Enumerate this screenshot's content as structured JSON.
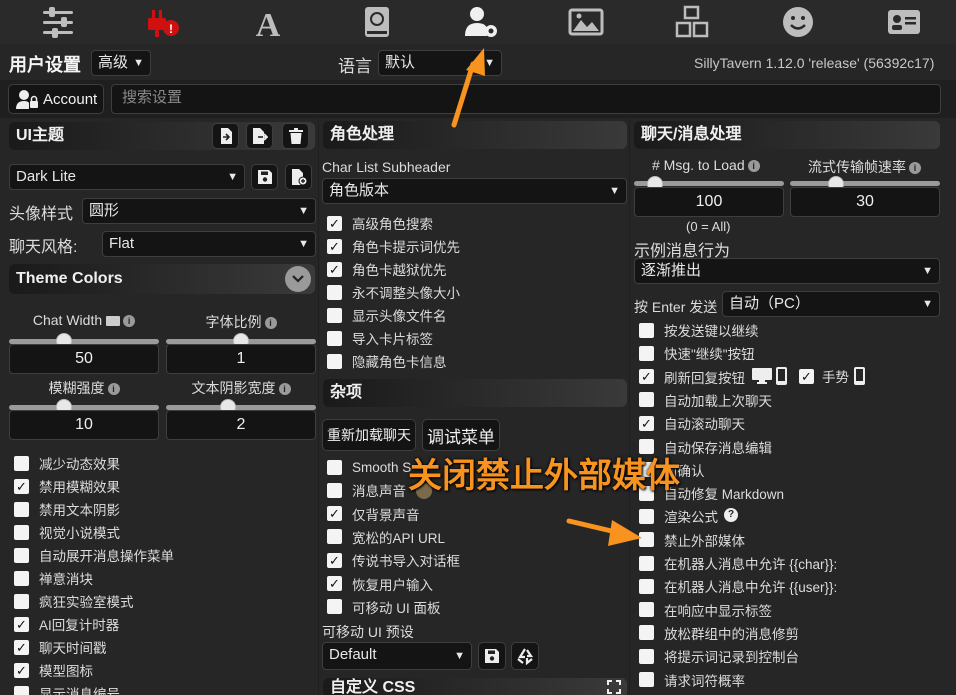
{
  "topbar": {
    "icons": [
      "sliders-icon",
      "plug-warning-icon",
      "font-icon",
      "book-globe-icon",
      "user-gear-icon",
      "image-icon",
      "cubes-icon",
      "smile-icon",
      "id-card-icon"
    ]
  },
  "header": {
    "title": "用户设置",
    "mode": "高级",
    "language_label": "语言",
    "language_value": "默认",
    "version": "SillyTavern 1.12.0 'release' (56392c17)"
  },
  "account": {
    "label": "Account",
    "search_placeholder": "搜索设置"
  },
  "ui_theme": {
    "title": "UI主题",
    "theme": "Dark Lite",
    "avatar_style_label": "头像样式",
    "avatar_style": "圆形",
    "chat_style_label": "聊天风格:",
    "chat_style": "Flat",
    "theme_colors": "Theme Colors",
    "sliders": [
      {
        "label": "Chat Width",
        "value": "50",
        "fraction": 0.35
      },
      {
        "label": "字体比例",
        "value": "1",
        "fraction": 0.5
      },
      {
        "label": "模糊强度",
        "value": "10",
        "fraction": 0.35
      },
      {
        "label": "文本阴影宽度",
        "value": "2",
        "fraction": 0.4
      }
    ],
    "checkboxes": [
      {
        "label": "减少动态效果",
        "checked": false
      },
      {
        "label": "禁用模糊效果",
        "checked": true
      },
      {
        "label": "禁用文本阴影",
        "checked": false
      },
      {
        "label": "视觉小说模式",
        "checked": false
      },
      {
        "label": "自动展开消息操作菜单",
        "checked": false
      },
      {
        "label": "禅意消块",
        "checked": false
      },
      {
        "label": "疯狂实验室模式",
        "checked": false
      },
      {
        "label": "AI回复计时器",
        "checked": true
      },
      {
        "label": "聊天时间戳",
        "checked": true
      },
      {
        "label": "模型图标",
        "checked": true
      },
      {
        "label": "显示消息编号",
        "checked": false
      }
    ]
  },
  "char_handling": {
    "title": "角色处理",
    "subheader_label": "Char List Subheader",
    "subheader_value": "角色版本",
    "checkboxes": [
      {
        "label": "高级角色搜索",
        "checked": true
      },
      {
        "label": "角色卡提示词优先",
        "checked": true
      },
      {
        "label": "角色卡越狱优先",
        "checked": true
      },
      {
        "label": "永不调整头像大小",
        "checked": false
      },
      {
        "label": "显示头像文件名",
        "checked": false
      },
      {
        "label": "导入卡片标签",
        "checked": false
      },
      {
        "label": "隐藏角色卡信息",
        "checked": false
      }
    ]
  },
  "misc": {
    "title": "杂项",
    "reload_button": "重新加载聊天",
    "debug_button": "调试菜单",
    "checkboxes": [
      {
        "label": "Smooth S",
        "checked": false
      },
      {
        "label": "消息声音",
        "checked": false
      },
      {
        "label": "仅背景声音",
        "checked": true
      },
      {
        "label": "宽松的API URL",
        "checked": false
      },
      {
        "label": "传说书导入对话框",
        "checked": true
      },
      {
        "label": "恢复用户输入",
        "checked": true
      },
      {
        "label": "可移动 UI 面板",
        "checked": false
      }
    ],
    "preset_label": "可移动 UI 预设",
    "preset_value": "Default",
    "custom_css": "自定义 CSS"
  },
  "chat_handling": {
    "title": "聊天/消息处理",
    "msg_load_label": "# Msg. to Load",
    "msg_load_value": "100",
    "msg_load_fraction": 0.1,
    "msg_load_note": "(0 = All)",
    "stream_fps_label": "流式传输帧速率",
    "stream_fps_value": "30",
    "stream_fps_fraction": 0.28,
    "example_label": "示例消息行为",
    "example_value": "逐渐推出",
    "enter_label": "按 Enter 发送",
    "enter_value": "自动（PC）",
    "gesture_label": "手势",
    "checkboxes": [
      {
        "label": "按发送键以继续",
        "checked": false
      },
      {
        "label": "快速\"继续\"按钮",
        "checked": false
      },
      {
        "label": "刷新回复按钮",
        "checked": true
      },
      {
        "label": "自动加载上次聊天",
        "checked": false
      },
      {
        "label": "自动滚动聊天",
        "checked": true
      },
      {
        "label": "自动保存消息编辑",
        "checked": false
      },
      {
        "label": "前确认",
        "checked": false
      },
      {
        "label": "自动修复 Markdown",
        "checked": false
      },
      {
        "label": "渲染公式",
        "checked": false
      },
      {
        "label": "禁止外部媒体",
        "checked": false
      },
      {
        "label": "在机器人消息中允许 {{char}}:",
        "checked": false
      },
      {
        "label": "在机器人消息中允许 {{user}}:",
        "checked": false
      },
      {
        "label": "在响应中显示标签",
        "checked": false
      },
      {
        "label": "放松群组中的消息修剪",
        "checked": false
      },
      {
        "label": "将提示词记录到控制台",
        "checked": false
      },
      {
        "label": "请求词符概率",
        "checked": false
      }
    ]
  },
  "annotation": {
    "text": "关闭禁止外部媒体",
    "color": "#f7931e"
  }
}
